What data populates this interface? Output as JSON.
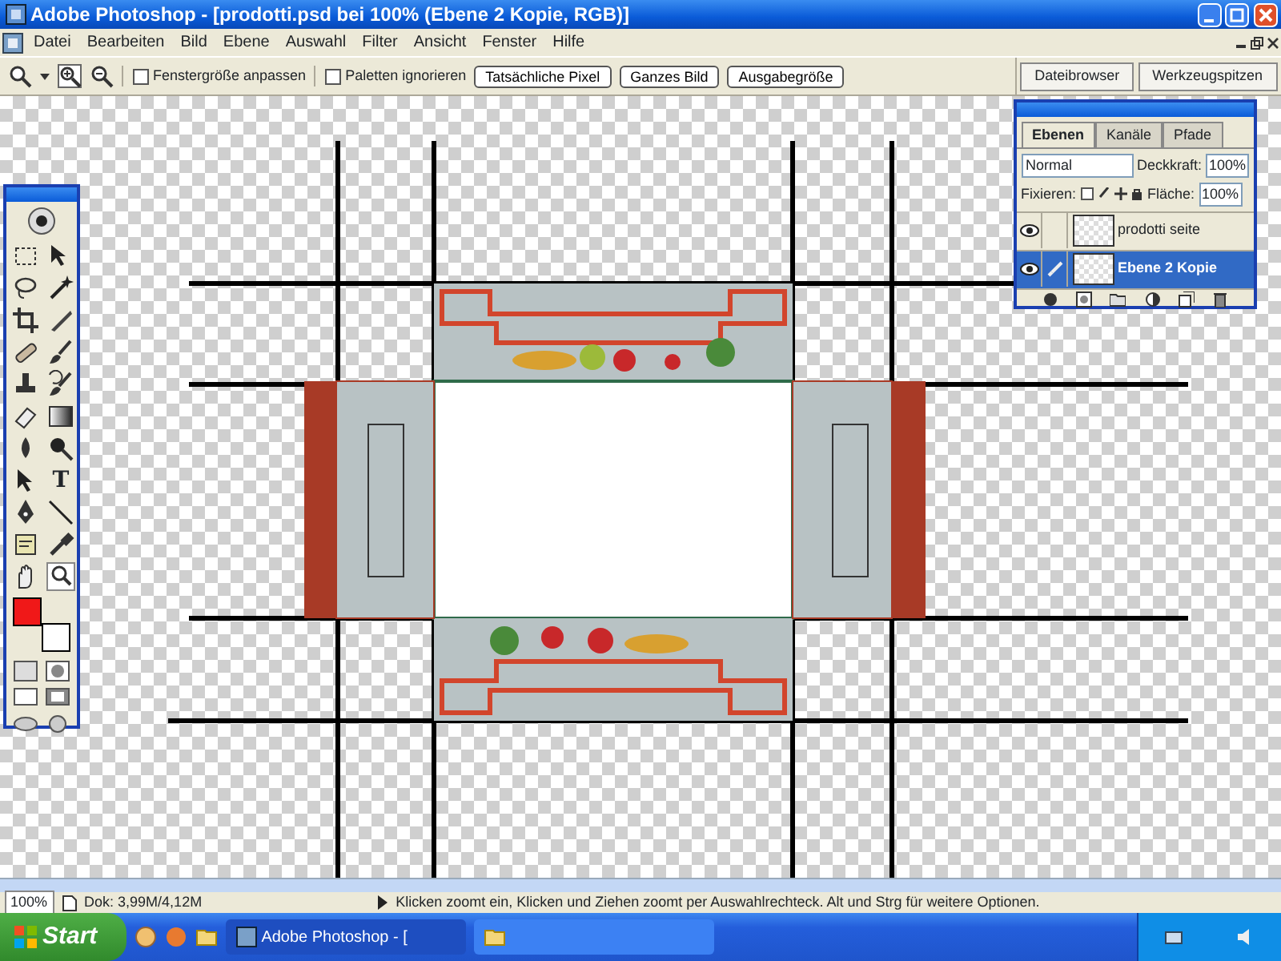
{
  "window": {
    "title": "Adobe Photoshop - [prodotti.psd bei 100% (Ebene 2 Kopie, RGB)]"
  },
  "menu": [
    "Datei",
    "Bearbeiten",
    "Bild",
    "Ebene",
    "Auswahl",
    "Filter",
    "Ansicht",
    "Fenster",
    "Hilfe"
  ],
  "options_bar": {
    "checkboxes": [
      {
        "label": "Fenstergröße anpassen",
        "checked": false
      },
      {
        "label": "Paletten ignorieren",
        "checked": false
      }
    ],
    "buttons": [
      "Tatsächliche Pixel",
      "Ganzes Bild",
      "Ausgabegröße"
    ],
    "palette_well_tabs": [
      "Dateibrowser",
      "Werkzeugspitzen"
    ]
  },
  "tools_palette": {
    "type_tool": "T",
    "color_swatches": [
      {
        "kind": "foreground",
        "color": "#f01818"
      },
      {
        "kind": "background",
        "color": "#ffffff"
      }
    ]
  },
  "layers_palette": {
    "tabs": [
      {
        "label": "Ebenen",
        "selected": true
      },
      {
        "label": "Kanäle",
        "selected": false
      },
      {
        "label": "Pfade",
        "selected": false
      }
    ],
    "blend_mode": "Normal",
    "opacity_label": "Deckkraft:",
    "opacity": "100%",
    "lock_label": "Fixieren:",
    "fill_label": "Fläche:",
    "fill": "100%",
    "layers": [
      {
        "name": "prodotti seite",
        "visible": true,
        "selected": false
      },
      {
        "name": "Ebene 2 Kopie",
        "visible": true,
        "selected": true
      }
    ]
  },
  "status_bar": {
    "zoom": "100%",
    "document": "Dok: 3,99M/4,12M",
    "hint": "Klicken zoomt ein, Klicken und Ziehen zoomt per Auswahlrechteck. Alt und Strg für weitere Optionen."
  },
  "taskbar": {
    "start": "Start",
    "tasks": [
      {
        "label": "Adobe Photoshop - [",
        "selected": true
      },
      {
        "selected": false
      }
    ]
  }
}
